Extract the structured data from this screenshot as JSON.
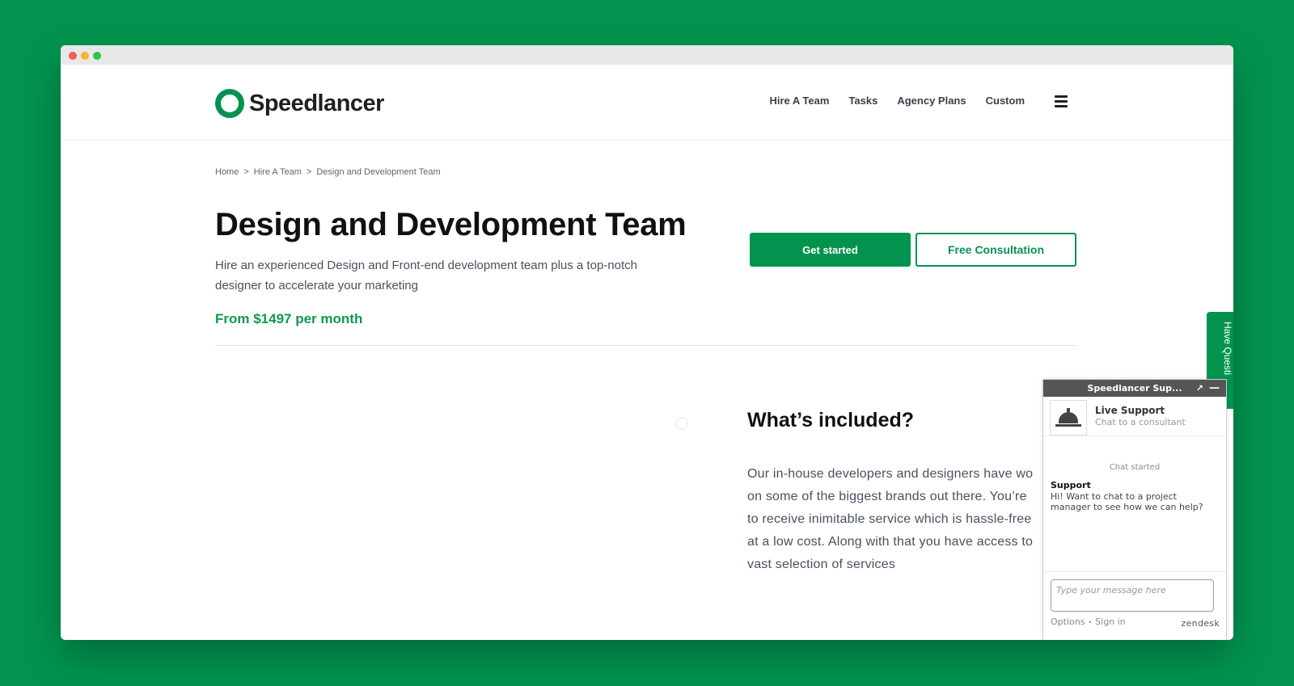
{
  "header": {
    "logo_text": "Speedlancer",
    "nav": [
      "Hire A Team",
      "Tasks",
      "Agency Plans",
      "Custom"
    ]
  },
  "breadcrumb": [
    "Home",
    "Hire A Team",
    "Design and Development Team"
  ],
  "hero": {
    "title": "Design and Development Team",
    "description": "Hire an experienced Design and Front-end development team plus a top-notch designer to accelerate your marketing",
    "price": "From $1497 per month",
    "primary_button": "Get started",
    "secondary_button": "Free Consultation"
  },
  "included": {
    "title": "What’s included?",
    "lines": [
      "Our in-house developers and designers have wo",
      "on some of the biggest brands out there. You’re",
      "to receive inimitable service which is hassle-free",
      "at a low cost. Along with that you have access to",
      "vast selection of services"
    ]
  },
  "side_tab": "Have Questi",
  "chat": {
    "title": "Speedlancer Sup...",
    "agent_name": "Live Support",
    "agent_sub": "Chat to a consultant",
    "started": "Chat started",
    "message_author": "Support",
    "message_text": "Hi! Want to chat to a project manager to see how we can help?",
    "input_placeholder": "Type your message here",
    "footer_options": "Options",
    "footer_signin": "Sign in",
    "brand": "zendesk"
  },
  "colors": {
    "background": "#02944f",
    "accent": "#02944f",
    "price": "#0f9a4f"
  }
}
